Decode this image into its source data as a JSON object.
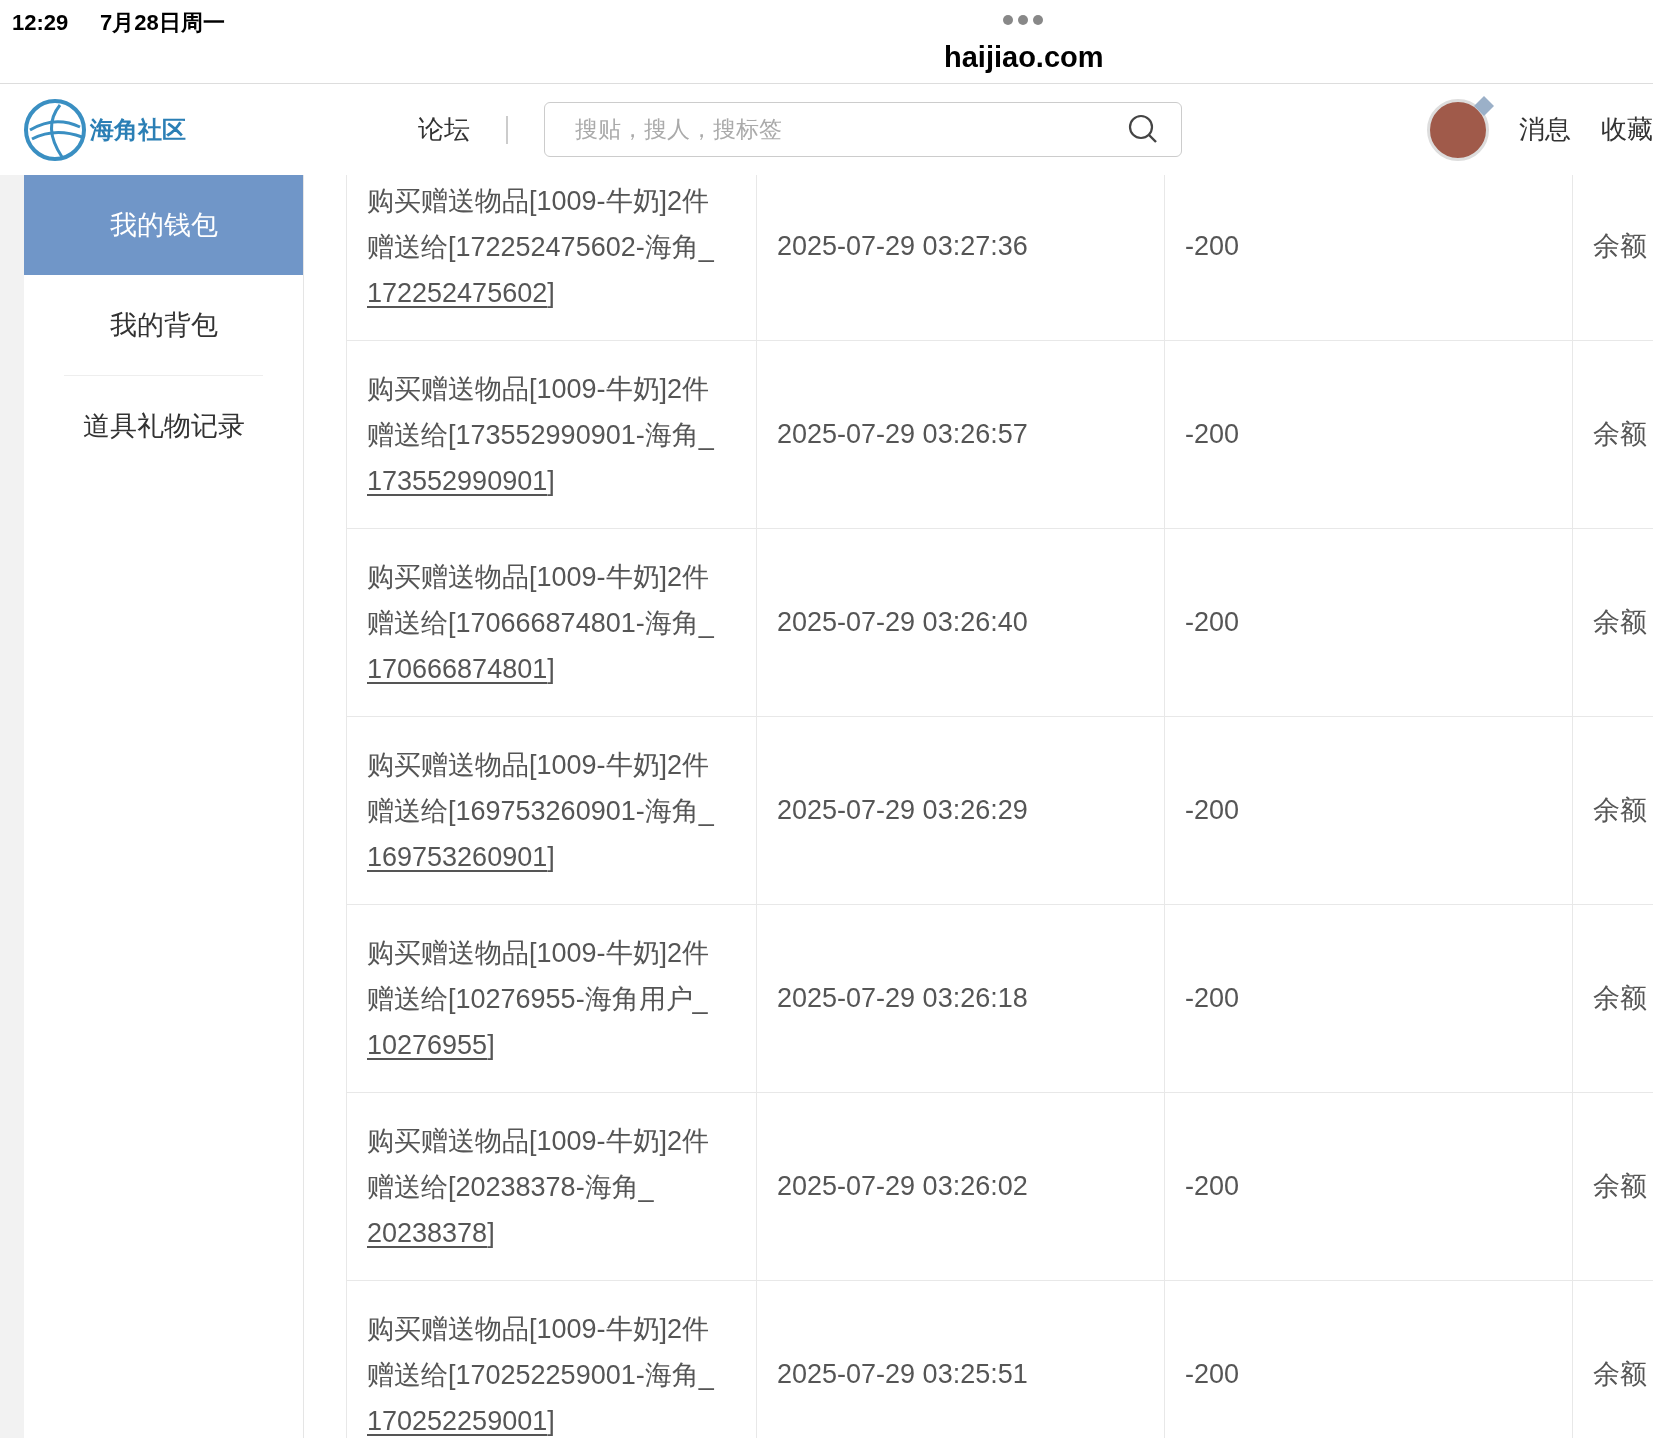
{
  "status_bar": {
    "time": "12:29",
    "date": "7月28日周一",
    "url": "haijiao.com"
  },
  "header": {
    "logo_text": "海角社区",
    "nav": [
      {
        "label": "论坛"
      }
    ],
    "search": {
      "placeholder": "搜贴，搜人，搜标签"
    },
    "menu": [
      {
        "label": "消息"
      },
      {
        "label": "收藏"
      }
    ]
  },
  "sidebar": {
    "items": [
      {
        "label": "我的钱包",
        "selected": true
      },
      {
        "label": "我的背包",
        "selected": false
      },
      {
        "label": "道具礼物记录",
        "selected": false
      }
    ]
  },
  "table": {
    "rows": [
      {
        "description": {
          "prefix": "购买赠送物品[1009-牛奶]2件赠送给[172252475602-海角_",
          "link": "172252475602",
          "suffix": "]"
        },
        "time": "2025-07-29 03:27:36",
        "amount": "-200",
        "column_4": "余额"
      },
      {
        "description": {
          "prefix": "购买赠送物品[1009-牛奶]2件赠送给[173552990901-海角_",
          "link": "173552990901",
          "suffix": "]"
        },
        "time": "2025-07-29 03:26:57",
        "amount": "-200",
        "column_4": "余额"
      },
      {
        "description": {
          "prefix": "购买赠送物品[1009-牛奶]2件赠送给[170666874801-海角_",
          "link": "170666874801",
          "suffix": "]"
        },
        "time": "2025-07-29 03:26:40",
        "amount": "-200",
        "column_4": "余额"
      },
      {
        "description": {
          "prefix": "购买赠送物品[1009-牛奶]2件赠送给[169753260901-海角_",
          "link": "169753260901",
          "suffix": "]"
        },
        "time": "2025-07-29 03:26:29",
        "amount": "-200",
        "column_4": "余额"
      },
      {
        "description": {
          "prefix": "购买赠送物品[1009-牛奶]2件赠送给[10276955-海角用户_",
          "link": "10276955",
          "suffix": "]"
        },
        "time": "2025-07-29 03:26:18",
        "amount": "-200",
        "column_4": "余额"
      },
      {
        "description": {
          "prefix": "购买赠送物品[1009-牛奶]2件赠送给[20238378-海角_",
          "link": "20238378",
          "suffix": "]"
        },
        "time": "2025-07-29 03:26:02",
        "amount": "-200",
        "column_4": "余额"
      },
      {
        "description": {
          "prefix": "购买赠送物品[1009-牛奶]2件赠送给[170252259001-海角_",
          "link": "170252259001",
          "suffix": "]"
        },
        "time": "2025-07-29 03:25:51",
        "amount": "-200",
        "column_4": "余额"
      }
    ]
  }
}
